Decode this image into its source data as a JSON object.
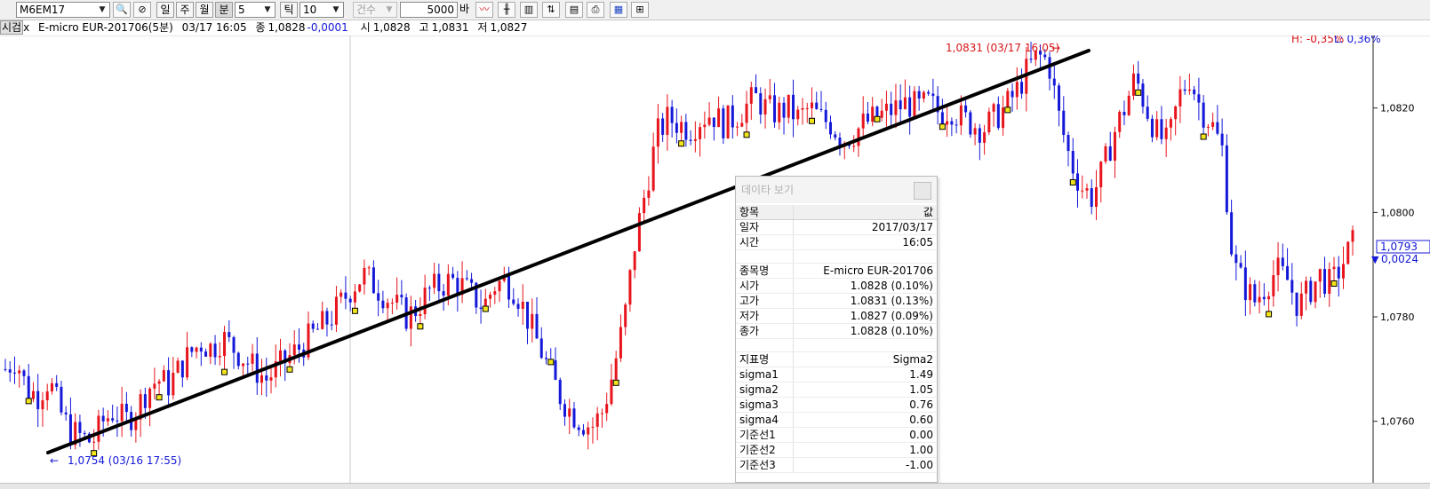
{
  "toolbar": {
    "symbol": "M6EM17",
    "period_buttons": [
      "일",
      "주",
      "월",
      "분"
    ],
    "selected_period": "분",
    "period_value": "5",
    "tick_label": "틱",
    "tick_value": "10",
    "volume_placeholder": "건수",
    "bar_count": "5000",
    "bar_unit": "바"
  },
  "info": {
    "panel_label": "시검",
    "close_x": "x",
    "title": "E-micro EUR-201706(5분)",
    "datetime": "03/17 16:05",
    "close_label": "종",
    "close": "1,0828",
    "change": "-0,0001",
    "open_label": "시",
    "open": "1,0828",
    "high_label": "고",
    "high": "1,0831",
    "low_label": "저",
    "low": "1,0827"
  },
  "chart": {
    "hl_high": "H: -0,35%",
    "hl_low": "L: 0,36%",
    "max_label": "1,0831 (03/17 16:05)",
    "min_label": "1,0754 (03/16 17:55)",
    "current_price": "1,0793",
    "current_change": "0,0024",
    "colors": {
      "up": "#e8141c",
      "down": "#1418d8",
      "trendline": "#000000",
      "axis_text": "#000000"
    }
  },
  "chart_data": {
    "type": "candlestick",
    "yaxis_ticks": [
      "1,0820",
      "1,0800",
      "1,0780",
      "1,0760"
    ],
    "trendline": {
      "from": 1.0754,
      "to": 1.0831
    },
    "close_path": [
      1.077,
      1.0772,
      1.0766,
      1.0765,
      1.0768,
      1.0762,
      1.0758,
      1.0757,
      1.0756,
      1.076,
      1.0762,
      1.076,
      1.0762,
      1.0766,
      1.0768,
      1.0767,
      1.077,
      1.0773,
      1.0775,
      1.0774,
      1.0776,
      1.0774,
      1.0772,
      1.077,
      1.0768,
      1.077,
      1.0772,
      1.0774,
      1.0776,
      1.0778,
      1.078,
      1.0783,
      1.0786,
      1.0788,
      1.0786,
      1.0784,
      1.0782,
      1.078,
      1.0782,
      1.0785,
      1.0786,
      1.0787,
      1.0786,
      1.0784,
      1.0782,
      1.0786,
      1.0787,
      1.0785,
      1.078,
      1.0775,
      1.077,
      1.0765,
      1.0762,
      1.076,
      1.0759,
      1.0762,
      1.077,
      1.078,
      1.0795,
      1.0805,
      1.0815,
      1.0818,
      1.0817,
      1.0816,
      1.0818,
      1.0819,
      1.0817,
      1.0818,
      1.082,
      1.0822,
      1.082,
      1.0819,
      1.082,
      1.0818,
      1.082,
      1.0818,
      1.0817,
      1.0814,
      1.0815,
      1.0817,
      1.0818,
      1.0819,
      1.082,
      1.0821,
      1.082,
      1.0821,
      1.0819,
      1.082,
      1.0818,
      1.0817,
      1.0816,
      1.0818,
      1.082,
      1.0823,
      1.0827,
      1.083,
      1.0829,
      1.0818,
      1.081,
      1.0805,
      1.0803,
      1.0808,
      1.0815,
      1.082,
      1.0826,
      1.082,
      1.0815,
      1.0813,
      1.0822,
      1.0826,
      1.082,
      1.0817,
      1.0812,
      1.079,
      1.0786,
      1.0783,
      1.0786,
      1.0789,
      1.0787,
      1.0782,
      1.0785,
      1.0788,
      1.0786,
      1.079,
      1.0794
    ]
  },
  "data_window": {
    "title": "데이타 보기",
    "header": {
      "item": "항목",
      "value": "값"
    },
    "rows1": [
      {
        "label": "일자",
        "value": "2017/03/17"
      },
      {
        "label": "시간",
        "value": "16:05"
      }
    ],
    "rows2": [
      {
        "label": "종목명",
        "value": "E-micro EUR-201706"
      },
      {
        "label": "시가",
        "value": "1.0828 (0.10%)"
      },
      {
        "label": "고가",
        "value": "1.0831 (0.13%)"
      },
      {
        "label": "저가",
        "value": "1.0827 (0.09%)"
      },
      {
        "label": "종가",
        "value": "1.0828 (0.10%)"
      }
    ],
    "rows3": [
      {
        "label": "지표명",
        "value": "Sigma2"
      },
      {
        "label": "sigma1",
        "value": "1.49"
      },
      {
        "label": "sigma2",
        "value": "1.05"
      },
      {
        "label": "sigma3",
        "value": "0.76"
      },
      {
        "label": "sigma4",
        "value": "0.60"
      },
      {
        "label": "기준선1",
        "value": "0.00"
      },
      {
        "label": "기준선2",
        "value": "1.00"
      },
      {
        "label": "기준선3",
        "value": "-1.00"
      }
    ]
  }
}
